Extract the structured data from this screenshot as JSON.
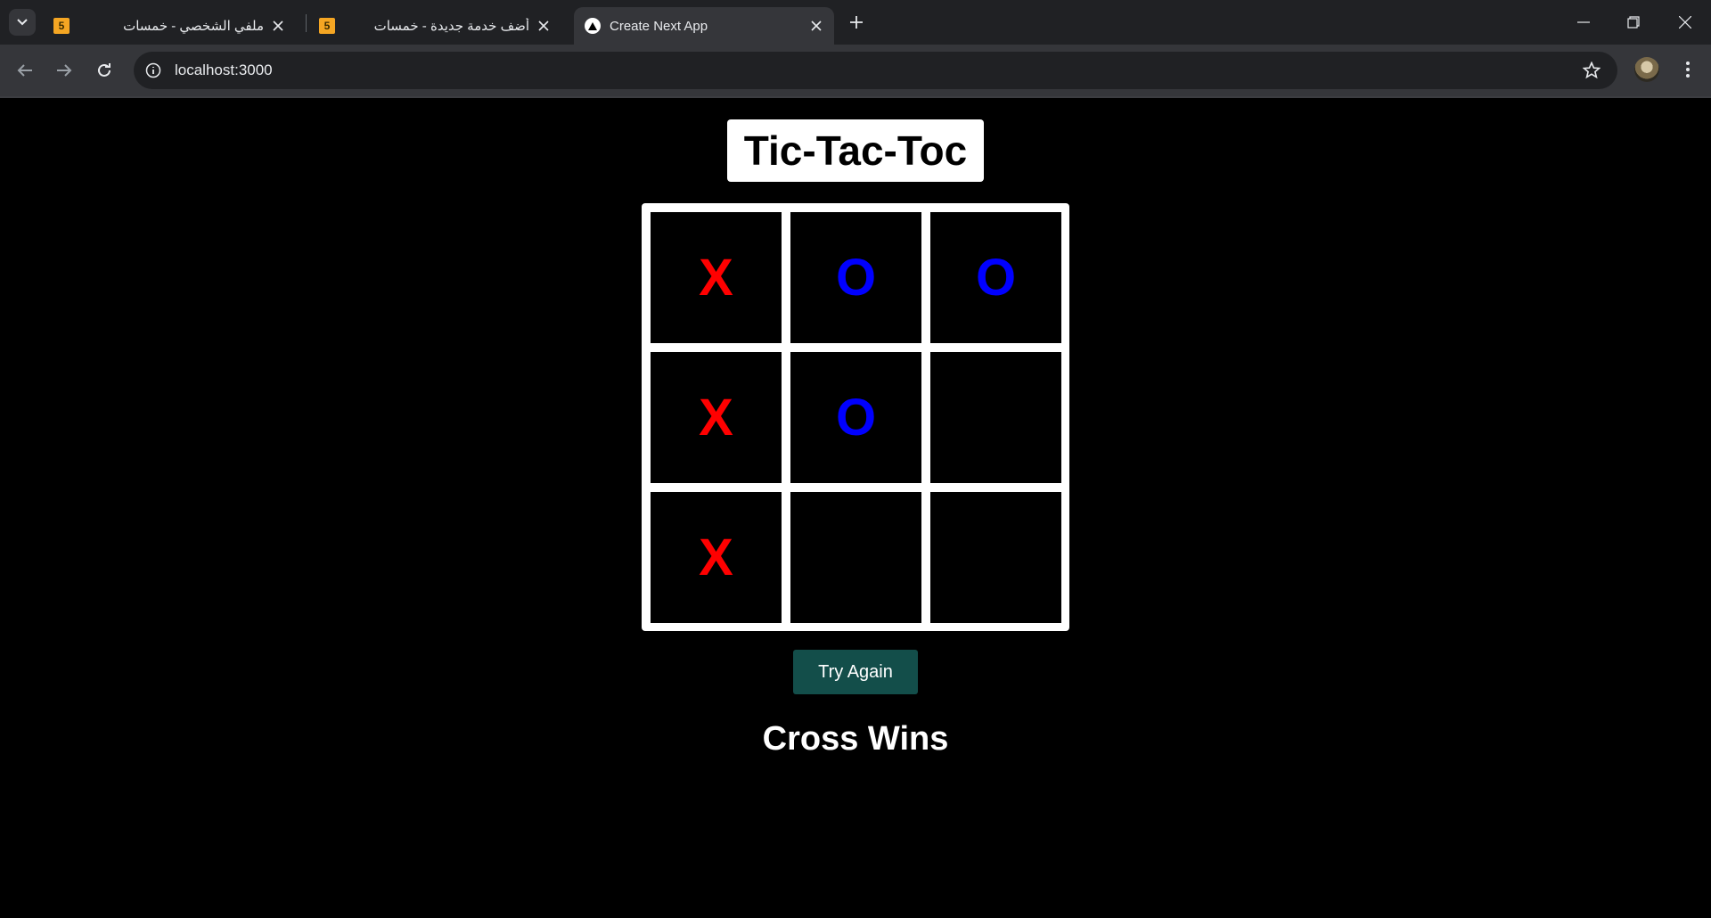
{
  "browser": {
    "tabs": [
      {
        "title": "ملفي الشخصي - خمسات",
        "favicon": "5",
        "active": false
      },
      {
        "title": "أضف خدمة جديدة - خمسات",
        "favicon": "5",
        "active": false
      },
      {
        "title": "Create Next App",
        "favicon": "nextjs-icon",
        "active": true
      }
    ],
    "url": "localhost:3000"
  },
  "game": {
    "title": "Tic-Tac-Toc",
    "board": [
      [
        "X",
        "O",
        "O"
      ],
      [
        "X",
        "O",
        ""
      ],
      [
        "X",
        "",
        ""
      ]
    ],
    "x_color": "#ff0000",
    "o_color": "#0000ff",
    "try_again_label": "Try Again",
    "result": "Cross Wins"
  }
}
